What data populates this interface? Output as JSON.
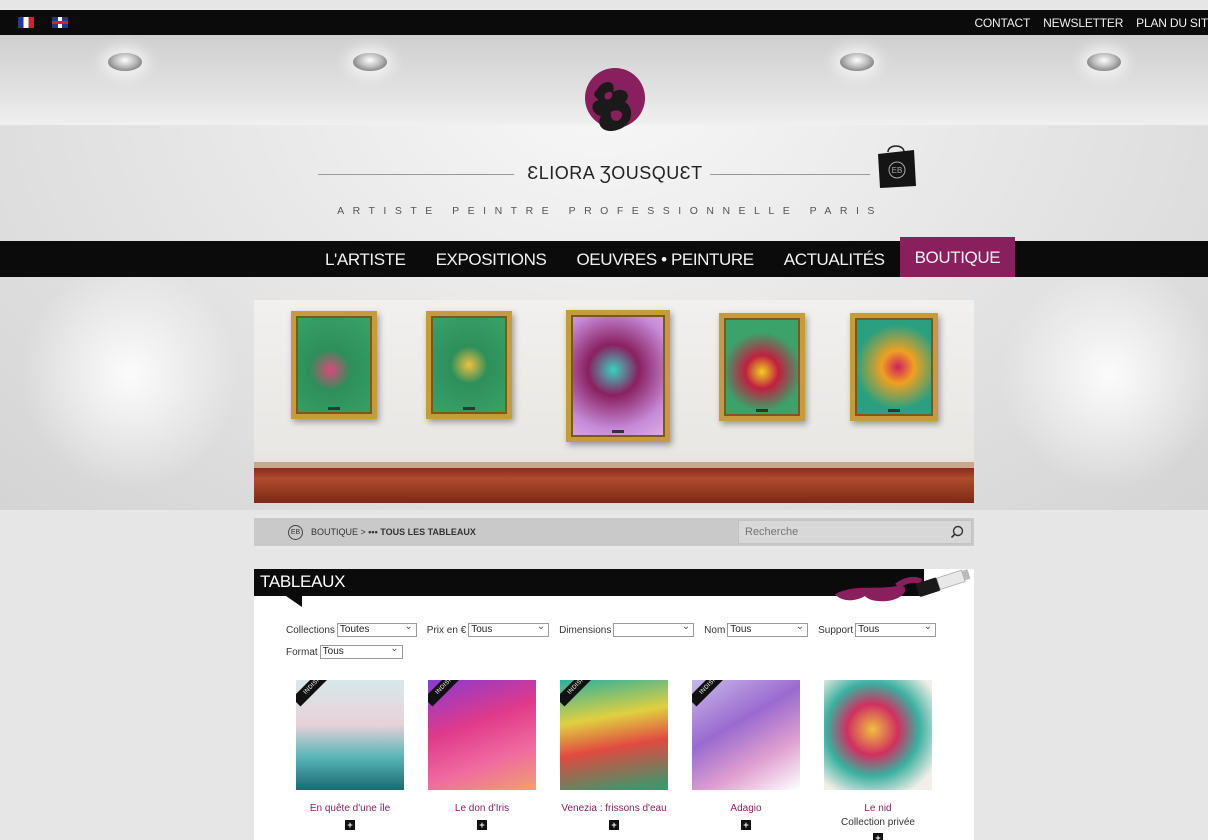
{
  "topbar": {
    "flags": [
      "fr-flag-icon",
      "uk-flag-icon"
    ],
    "links": [
      "CONTACT",
      "NEWSLETTER",
      "PLAN DU SIT"
    ]
  },
  "header": {
    "logo_name": "ƐLIORA ƷOUSQUƐT",
    "tagline": "ARTISTE PEINTRE PROFESSIONNELLE PARIS",
    "accent_color": "#8a1f5e"
  },
  "nav": {
    "items": [
      {
        "label": "L'ARTISTE"
      },
      {
        "label": "EXPOSITIONS"
      },
      {
        "label": "OEUVRES • PEINTURE"
      },
      {
        "label": "ACTUALITÉS"
      },
      {
        "label": "BOUTIQUE",
        "active": true
      }
    ]
  },
  "breadcrumb": {
    "root": "BOUTIQUE",
    "separator": " > ",
    "current": "••• TOUS LES TABLEAUX"
  },
  "search": {
    "placeholder": "Recherche"
  },
  "section": {
    "title": "TABLEAUX"
  },
  "filters": {
    "collections": {
      "label": "Collections",
      "value": "Toutes"
    },
    "prix": {
      "label": "Prix en €",
      "value": "Tous"
    },
    "dimensions": {
      "label": "Dimensions",
      "value": ""
    },
    "nom": {
      "label": "Nom",
      "value": "Tous"
    },
    "support": {
      "label": "Support",
      "value": "Tous"
    },
    "format": {
      "label": "Format",
      "value": "Tous"
    }
  },
  "products": [
    {
      "name": "En quête d'une île",
      "ribbon": "INDISPONIBLE",
      "status": ""
    },
    {
      "name": "Le don d'Iris",
      "ribbon": "INDISPONIBLE",
      "status": ""
    },
    {
      "name": "Venezia : frissons d'eau",
      "ribbon": "INDISPONIBLE",
      "status": ""
    },
    {
      "name": "Adagio",
      "ribbon": "INDISPONIBLE",
      "status": ""
    },
    {
      "name": "Le nid",
      "ribbon": "",
      "status": "Collection privée"
    }
  ],
  "plus_symbol": "+"
}
